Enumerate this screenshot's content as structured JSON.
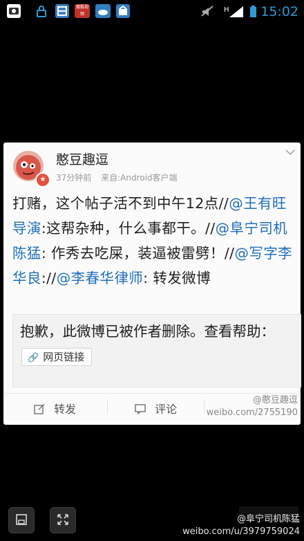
{
  "status_bar": {
    "time": "15:02",
    "left_icons": [
      "camera-icon",
      "lock-icon",
      "notes-icon",
      "video-app-icon",
      "weather-icon",
      "store-icon"
    ],
    "video_app_label": "搜狐视频",
    "right_icons": [
      "mute-icon",
      "signal-icon",
      "battery-icon"
    ],
    "network_label": "H"
  },
  "post": {
    "username": "憨豆趣逗",
    "time_ago": "37分钟前",
    "source": "来自:Android客户端",
    "segments": [
      {
        "text": "打赌，这个帖子活不到中午12点//",
        "mention": false
      },
      {
        "text": "@王有旺导演",
        "mention": true
      },
      {
        "text": ":这帮杂种，什么事都干。//",
        "mention": false
      },
      {
        "text": "@阜宁司机陈猛",
        "mention": true
      },
      {
        "text": ": 作秀去吃屎，装逼被雷劈！//",
        "mention": false
      },
      {
        "text": "@写字李华良",
        "mention": true
      },
      {
        "text": "://",
        "mention": false
      },
      {
        "text": "@李春华律师",
        "mention": true
      },
      {
        "text": ": 转发微博",
        "mention": false
      }
    ],
    "quote_text": "抱歉，此微博已被作者删除。查看帮助：",
    "weblink_label": "网页链接",
    "actions": {
      "repost": "转发",
      "comment": "评论"
    },
    "watermark_name": "@憨豆趣逗",
    "watermark_url": "weibo.com/2755190"
  },
  "bottom": {
    "watermark_name": "@阜宁司机陈猛",
    "watermark_url": "weibo.com/u/3979759024"
  },
  "colors": {
    "mention": "#1f6fbd",
    "time_blue": "#2e9bd6",
    "card_bg": "#fbfbfb"
  }
}
